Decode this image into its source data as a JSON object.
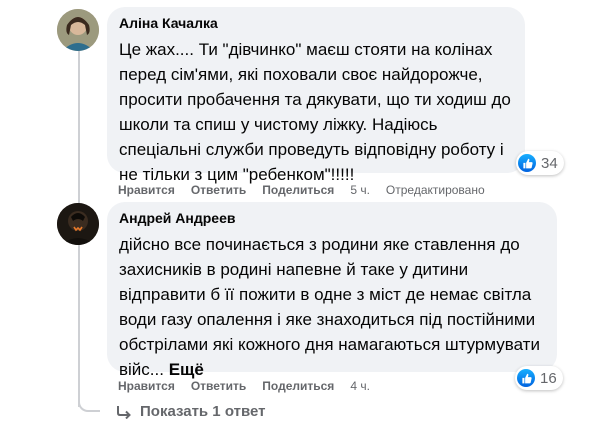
{
  "comments": [
    {
      "author": "Аліна Качалка",
      "text": "Це жах.... Ти \"дівчинко\" маєш стояти на колінах перед сім'ями, які поховали своє найдорожче, просити пробачення та дякувати, що ти ходиш до школи та спиш у чистому ліжку. Надіюсь спеціальні служби проведуть відповідну роботу і не тільки з цим \"ребенком\"!!!!!",
      "reaction_icon": "like-icon",
      "reaction_count": "34",
      "actions": {
        "like": "Нравится",
        "reply": "Ответить",
        "share": "Поделиться"
      },
      "time": "5 ч.",
      "edited": "Отредактировано"
    },
    {
      "author": "Андрей Андреев",
      "text": "дійсно все починається з родини яке ставлення до захисників в родині напевне й таке у дитини відправити б її пожити в одне з міст де немає світла води газу опалення і яке знаходиться під постійними обстрілами які кожного дня намагаються штурмувати війс...",
      "more": "Ещё",
      "reaction_icon": "like-icon",
      "reaction_count": "16",
      "actions": {
        "like": "Нравится",
        "reply": "Ответить",
        "share": "Поделиться"
      },
      "time": "4 ч."
    }
  ],
  "replies_link": "Показать 1 ответ"
}
